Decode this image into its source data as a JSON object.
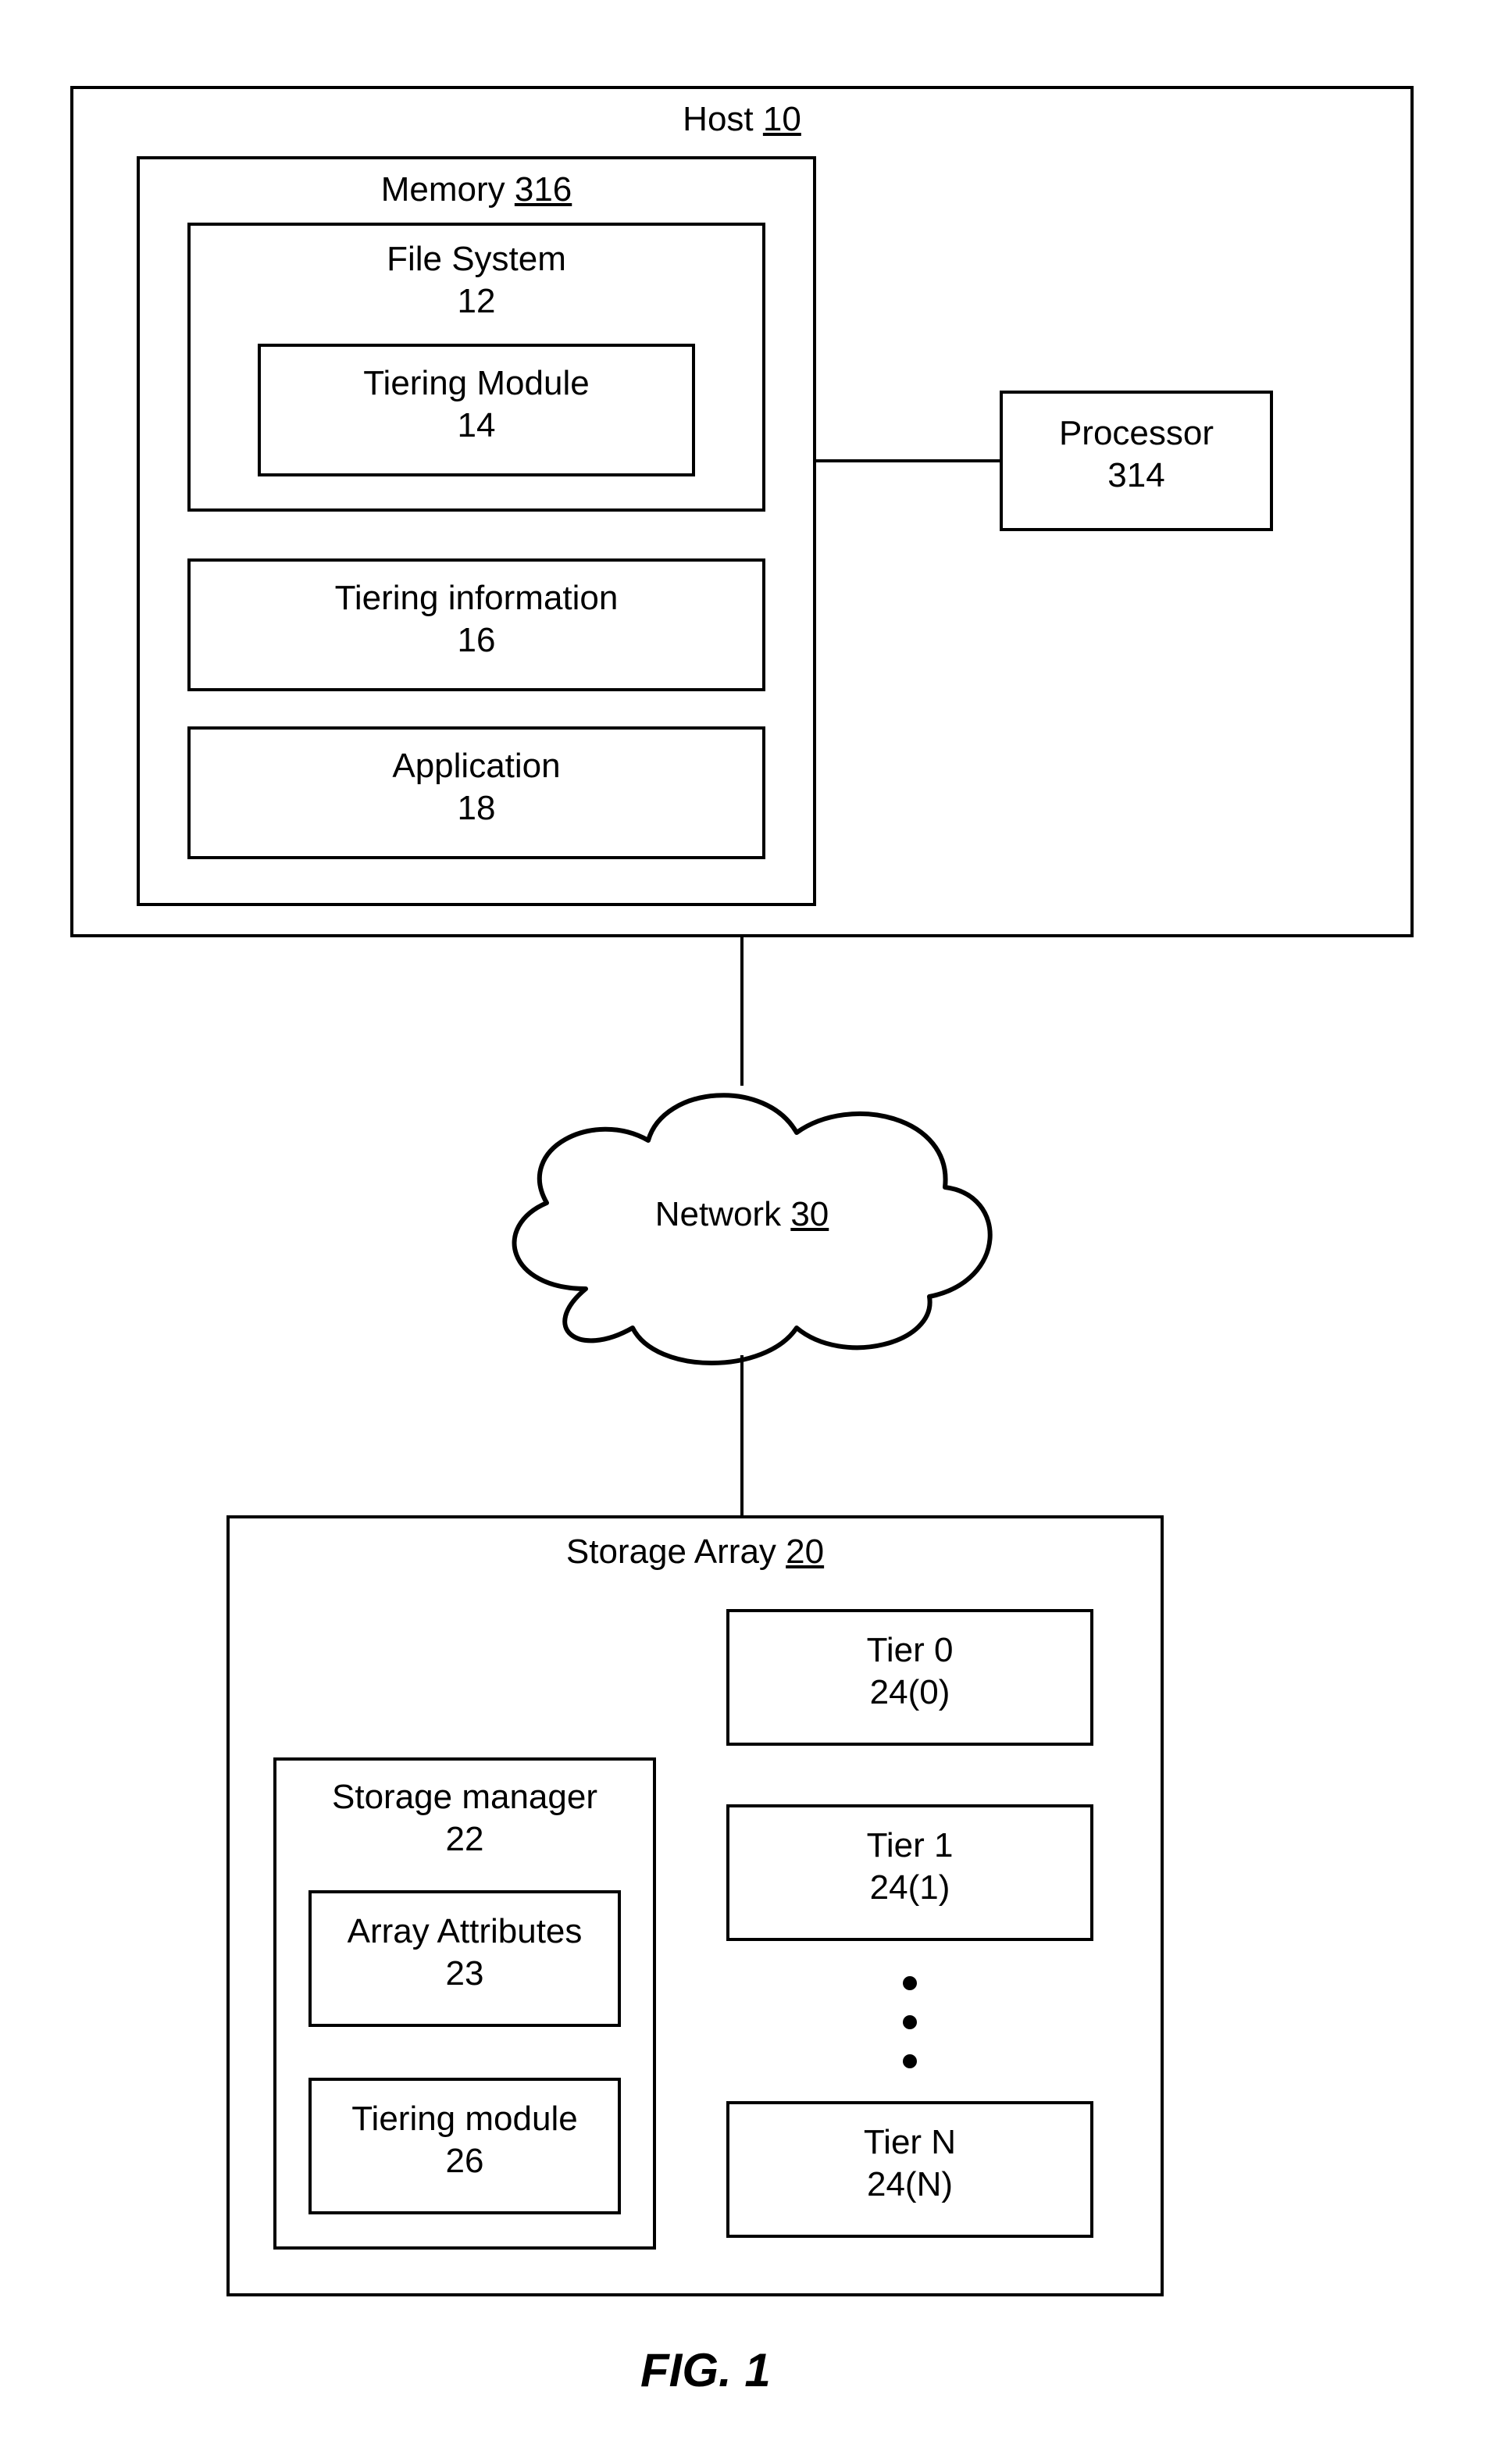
{
  "figure": {
    "caption": "FIG. 1"
  },
  "host": {
    "title": "Host ",
    "ref": "10",
    "memory": {
      "title": "Memory ",
      "ref": "316",
      "fileSystem": {
        "title": "File System",
        "ref": "12",
        "tieringModule": {
          "title": "Tiering Module",
          "ref": "14"
        }
      },
      "tieringInformation": {
        "title": "Tiering information",
        "ref": "16"
      },
      "application": {
        "title": "Application",
        "ref": "18"
      }
    },
    "processor": {
      "title": "Processor",
      "ref": "314"
    }
  },
  "network": {
    "title": "Network ",
    "ref": "30"
  },
  "storageArray": {
    "title": "Storage Array ",
    "ref": "20",
    "storageManager": {
      "title": "Storage manager",
      "ref": "22",
      "arrayAttributes": {
        "title": "Array Attributes",
        "ref": "23"
      },
      "tieringModule": {
        "title": "Tiering module",
        "ref": "26"
      }
    },
    "tiers": [
      {
        "title": "Tier 0",
        "ref": "24(0)"
      },
      {
        "title": "Tier 1",
        "ref": "24(1)"
      },
      {
        "title": "Tier N",
        "ref": "24(N)"
      }
    ]
  }
}
